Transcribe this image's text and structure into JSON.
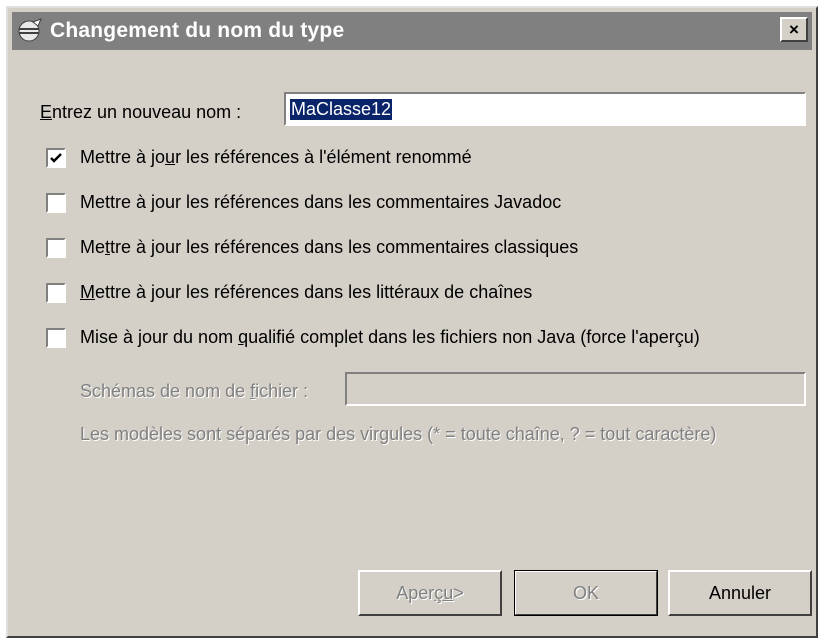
{
  "window": {
    "title": "Changement du nom du type",
    "close_glyph": "×",
    "icon": "eclipse-rename-icon"
  },
  "name_field": {
    "label_prefix": "",
    "label_mnemonic": "E",
    "label_rest": "ntrez un nouveau nom :",
    "value": "MaClasse12"
  },
  "options": [
    {
      "pre": "Mettre à jo",
      "mnemonic": "u",
      "post": "r les références à l'élément renommé",
      "checked": true
    },
    {
      "pre": "Mettre à jour les références dans les commentaires Javadoc",
      "mnemonic": "",
      "post": "",
      "checked": false
    },
    {
      "pre": "Me",
      "mnemonic": "t",
      "post": "tre à jour les références dans les commentaires classiques",
      "checked": false
    },
    {
      "pre": "",
      "mnemonic": "M",
      "post": "ettre à jour les références dans les littéraux de chaînes",
      "checked": false
    },
    {
      "pre": "Mise à jour du nom ",
      "mnemonic": "q",
      "post": "ualifié complet dans les fichiers non Java (force l'aperçu)",
      "checked": false
    }
  ],
  "patterns": {
    "label_pre": "Schémas de nom de ",
    "label_mnemonic": "f",
    "label_post": "ichier :",
    "value": "",
    "hint": "Les modèles sont séparés par des virgules (* = toute chaîne, ? = tout caractère)"
  },
  "buttons": {
    "preview_pre": "Aper",
    "preview_mnemonic": "çu",
    "preview_post": " >",
    "ok": "OK",
    "cancel": "Annuler"
  },
  "colors": {
    "titlebar": "#808080",
    "dialog_bg": "#d4d0c8",
    "selection": "#0a246a"
  }
}
